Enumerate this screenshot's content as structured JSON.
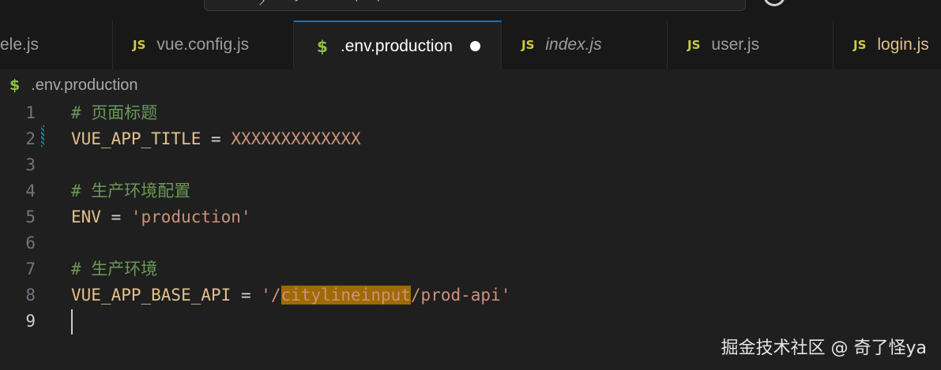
{
  "titlebar": {
    "search_text": "city-lifeline-input-pc-web"
  },
  "tabs": [
    {
      "label": "ele.js",
      "icon": "js-file-icon",
      "active": false
    },
    {
      "label": "vue.config.js",
      "icon": "js-file-icon",
      "active": false
    },
    {
      "label": ".env.production",
      "icon": "env-file-icon",
      "active": true,
      "dirty": true
    },
    {
      "label": "index.js",
      "icon": "js-file-icon",
      "active": false,
      "italic": true
    },
    {
      "label": "user.js",
      "icon": "js-file-icon",
      "active": false
    },
    {
      "label": "login.js",
      "icon": "js-file-icon",
      "active": false,
      "modified": true
    }
  ],
  "icons": {
    "js": "JS",
    "env": "$"
  },
  "breadcrumb": {
    "file": ".env.production"
  },
  "editor": {
    "line_numbers": [
      "1",
      "2",
      "3",
      "4",
      "5",
      "6",
      "7",
      "8",
      "9"
    ],
    "current_line": 9,
    "lines": {
      "l1": "# 页面标题",
      "l2_key": "VUE_APP_TITLE",
      "l2_op": " = ",
      "l2_val": "XXXXXXXXXXXXX",
      "l4": "# 生产环境配置",
      "l5_key": "ENV",
      "l5_op": " = ",
      "l5_val": "'production'",
      "l7": "# 生产环境",
      "l8_key": "VUE_APP_BASE_API",
      "l8_op": " = ",
      "l8_val_pre": "'/",
      "l8_val_hl": "citylineinput",
      "l8_val_post": "/prod-api'"
    }
  },
  "colors": {
    "accent": "#0078d4",
    "comment": "#6a9955",
    "string": "#ce9178",
    "highlight": "#9e6a03",
    "js_icon": "#cbcb41",
    "env_icon": "#8dc149"
  },
  "watermark": "掘金技术社区 @ 奇了怪ya"
}
